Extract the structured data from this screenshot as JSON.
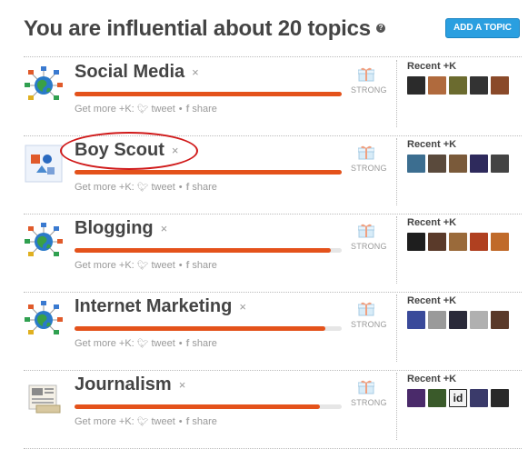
{
  "header": {
    "title": "You are influential about 20 topics",
    "help_icon": "question-icon",
    "add_topic_label": "ADD A TOPIC"
  },
  "labels": {
    "get_more": "Get more +K:",
    "tweet": "tweet",
    "share": "share",
    "recent": "Recent +K",
    "close": "×"
  },
  "topics": [
    {
      "name": "Social Media",
      "strength": "STRONG",
      "level": 1.0,
      "icon": "globe-network-icon",
      "avatars": [
        "#2b2b2b",
        "#b06a3d",
        "#6b6b2f",
        "#333333",
        "#8a4a2a"
      ]
    },
    {
      "name": "Boy Scout",
      "strength": "STRONG",
      "level": 1.0,
      "icon": "shapes-icon",
      "avatars": [
        "#3c6e90",
        "#5a4a3c",
        "#7a5a3a",
        "#2e2a5c",
        "#444444"
      ]
    },
    {
      "name": "Blogging",
      "strength": "STRONG",
      "level": 0.96,
      "icon": "globe-network-icon",
      "avatars": [
        "#1e1e1e",
        "#5a3a2a",
        "#9a6a3a",
        "#b04020",
        "#c06a2a"
      ]
    },
    {
      "name": "Internet Marketing",
      "strength": "STRONG",
      "level": 0.94,
      "icon": "globe-network-icon",
      "avatars": [
        "#3a4a9a",
        "#9a9a9a",
        "#2a2a3a",
        "#b0b0b0",
        "#5a3a2a"
      ]
    },
    {
      "name": "Journalism",
      "strength": "STRONG",
      "level": 0.92,
      "icon": "newspaper-icon",
      "avatars": [
        "#4a2a6a",
        "#3a5a2a",
        "#f2f2f2",
        "#3a3a6a",
        "#2a2a2a"
      ]
    }
  ],
  "avatar_badge": "id",
  "colors": {
    "accent": "#e4521b",
    "button": "#2a9fe0",
    "highlight_circle": "#d01919"
  }
}
